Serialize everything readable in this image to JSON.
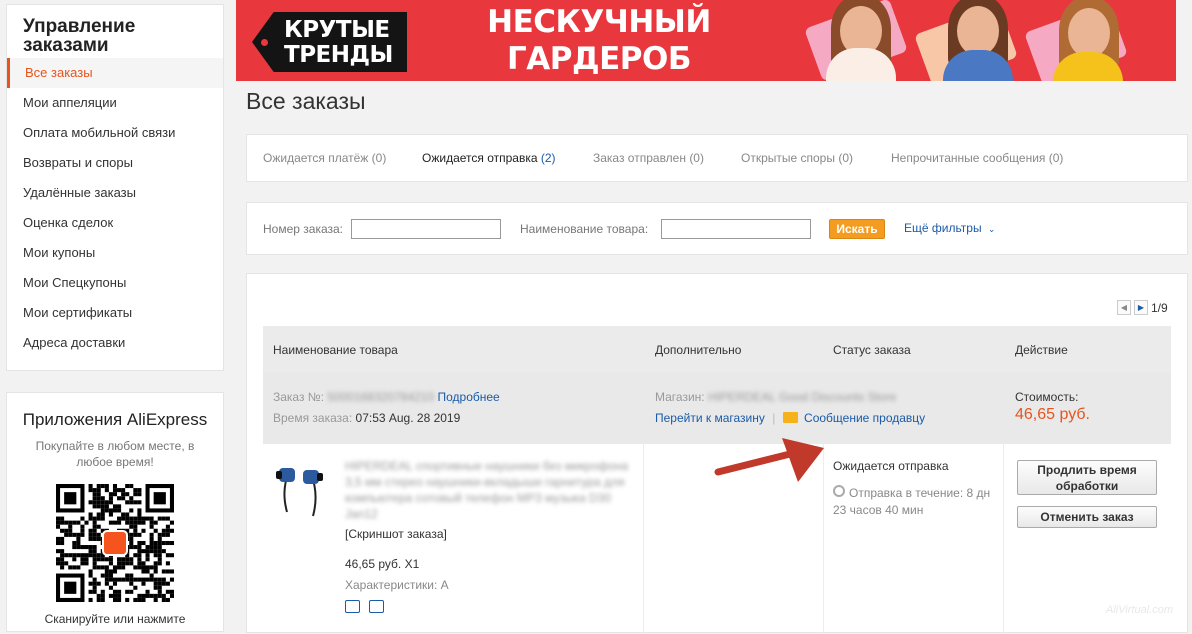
{
  "sidebar": {
    "title": "Управление заказами",
    "items": [
      {
        "label": "Все заказы",
        "active": true
      },
      {
        "label": "Мои аппеляции"
      },
      {
        "label": "Оплата мобильной связи"
      },
      {
        "label": "Возвраты и споры"
      },
      {
        "label": "Удалённые заказы"
      },
      {
        "label": "Оценка сделок"
      },
      {
        "label": "Мои купоны"
      },
      {
        "label": "Мои Спецкупоны"
      },
      {
        "label": "Мои сертификаты"
      },
      {
        "label": "Адреса доставки"
      }
    ]
  },
  "apps": {
    "title": "Приложения AliExpress",
    "subtitle": "Покупайте в любом месте, в любое время!",
    "scan_text": "Сканируйте или нажмите"
  },
  "banner": {
    "tag_text": "КРУТЫЕ ТРЕНДЫ",
    "headline": "НЕСКУЧНЫЙ ГАРДЕРОБ",
    "background_color": "#e8373d"
  },
  "page_title": "Все заказы",
  "tabs": [
    {
      "label": "Ожидается платёж",
      "count": "(0)"
    },
    {
      "label": "Ожидается отправка",
      "count": "(2)",
      "active": true
    },
    {
      "label": "Заказ отправлен",
      "count": "(0)"
    },
    {
      "label": "Открытые споры",
      "count": "(0)"
    },
    {
      "label": "Непрочитанные сообщения",
      "count": "(0)"
    }
  ],
  "filters": {
    "order_number_label": "Номер заказа:",
    "order_number_value": "",
    "product_name_label": "Наименование товара:",
    "product_name_value": "",
    "search_button": "Искать",
    "more_filters": "Ещё фильтры"
  },
  "pagination": {
    "text": "1/9"
  },
  "table": {
    "headers": [
      "Наименование товара",
      "Дополнительно",
      "Статус заказа",
      "Действие"
    ]
  },
  "order": {
    "order_label": "Заказ №:",
    "order_number": "5000168320784210",
    "details_link": "Подробнее",
    "time_label": "Время заказа:",
    "time_value": "07:53 Aug. 28 2019",
    "store_label": "Магазин:",
    "store_name": "HIPERDEAL Good Discounts Store",
    "go_to_store": "Перейти к магазину",
    "separator": "|",
    "message_seller": "Сообщение продавцу",
    "price_label": "Стоимость:",
    "price_value": "46,65 руб.",
    "product_title": "HIPERDEAL спортивные наушники без микрофона 3,5 мм стерео наушники-вкладыши гарнитура для компьютера сотовый телефон MP3 музыка D30 Jan12",
    "screenshot_link": "[Скриншот заказа]",
    "unit_price": "46,65 руб. X1",
    "characteristics": "Характеристики: A",
    "status": "Ожидается отправка",
    "status_time": "Отправка в течение: 8 дн 23 часов 40 мин",
    "extend_button": "Продлить время обработки",
    "cancel_button": "Отменить заказ"
  },
  "icons": {
    "message": "envelope-icon",
    "clock": "clock-icon",
    "delivery": "truck-icon",
    "snapshot": "snapshot-icon",
    "dropdown": "chevron-down-icon"
  },
  "colors": {
    "accent": "#e7541e",
    "link": "#1b5ba7",
    "search_button": "#f39c1f"
  },
  "watermark": "AliVirtual.com"
}
